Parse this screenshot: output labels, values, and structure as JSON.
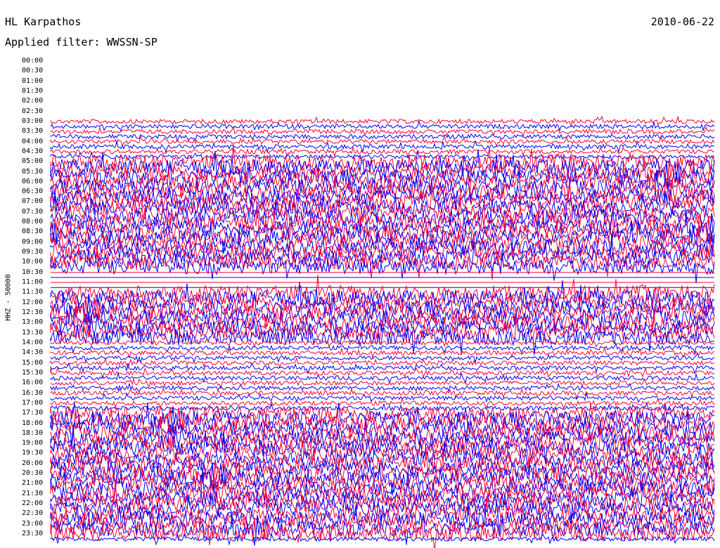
{
  "header": {
    "station": "HL Karpathos",
    "filter": "Applied filter: WWSSN-SP",
    "date": "2010-06-22"
  },
  "channel_label": "HHZ - 50000",
  "colors": {
    "trace_a": "#ff0033",
    "trace_b": "#0000ff",
    "background": "#ffffff",
    "text": "#000000"
  },
  "chart_data": {
    "type": "line",
    "title": "HL Karpathos",
    "subtitle": "Applied filter: WWSSN-SP",
    "date": "2010-06-22",
    "ylabel": "HHZ - 50000",
    "grid": false,
    "y_ticks": [
      "00:00",
      "00:30",
      "01:00",
      "01:30",
      "02:00",
      "02:30",
      "03:00",
      "03:30",
      "04:00",
      "04:30",
      "05:00",
      "05:30",
      "06:00",
      "06:30",
      "07:00",
      "07:30",
      "08:00",
      "08:30",
      "09:00",
      "09:30",
      "10:00",
      "10:30",
      "11:00",
      "11:30",
      "12:00",
      "12:30",
      "13:00",
      "13:30",
      "14:00",
      "14:30",
      "15:00",
      "15:30",
      "16:00",
      "16:30",
      "17:00",
      "17:30",
      "18:00",
      "18:30",
      "19:00",
      "19:30",
      "20:00",
      "20:30",
      "21:00",
      "21:30",
      "22:00",
      "22:30",
      "23:00",
      "23:30"
    ],
    "trace_start_row": "03:00",
    "row_duration_minutes": 15,
    "row_colors": [
      "#ff0033",
      "#0000ff"
    ],
    "activity_profile": [
      {
        "from": "03:00",
        "to": "05:00",
        "level": "low"
      },
      {
        "from": "05:00",
        "to": "10:30",
        "level": "high"
      },
      {
        "from": "10:30",
        "to": "11:30",
        "level": "gap"
      },
      {
        "from": "11:30",
        "to": "14:00",
        "level": "high"
      },
      {
        "from": "14:00",
        "to": "17:30",
        "level": "low"
      },
      {
        "from": "17:30",
        "to": "23:45",
        "level": "high"
      }
    ]
  }
}
